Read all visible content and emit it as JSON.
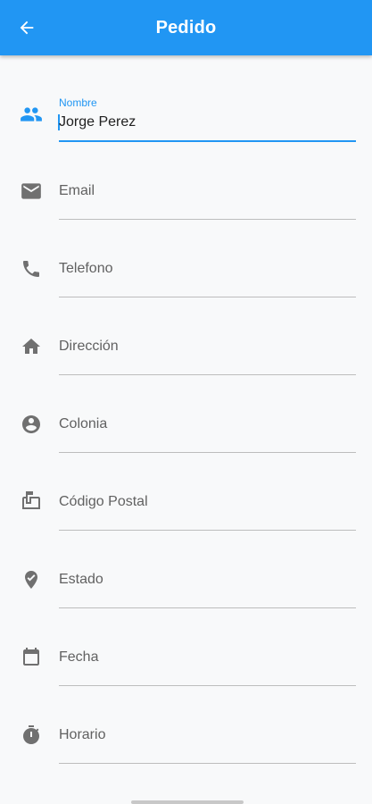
{
  "appbar": {
    "title": "Pedido",
    "back_icon": "arrow-back-icon",
    "color": "#2196f3"
  },
  "fields": [
    {
      "key": "nombre",
      "label": "Nombre",
      "value": "Jorge Perez",
      "icon": "people-icon",
      "active": true
    },
    {
      "key": "email",
      "label": "Email",
      "value": "",
      "icon": "email-icon",
      "active": false
    },
    {
      "key": "telefono",
      "label": "Telefono",
      "value": "",
      "icon": "phone-icon",
      "active": false
    },
    {
      "key": "direccion",
      "label": "Dirección",
      "value": "",
      "icon": "home-icon",
      "active": false
    },
    {
      "key": "colonia",
      "label": "Colonia",
      "value": "",
      "icon": "account-circle-icon",
      "active": false
    },
    {
      "key": "codigo_postal",
      "label": "Código Postal",
      "value": "",
      "icon": "mailbox-icon",
      "active": false
    },
    {
      "key": "estado",
      "label": "Estado",
      "value": "",
      "icon": "location-pin-icon",
      "active": false
    },
    {
      "key": "fecha",
      "label": "Fecha",
      "value": "",
      "icon": "calendar-icon",
      "active": false
    },
    {
      "key": "horario",
      "label": "Horario",
      "value": "",
      "icon": "timer-icon",
      "active": false
    }
  ]
}
